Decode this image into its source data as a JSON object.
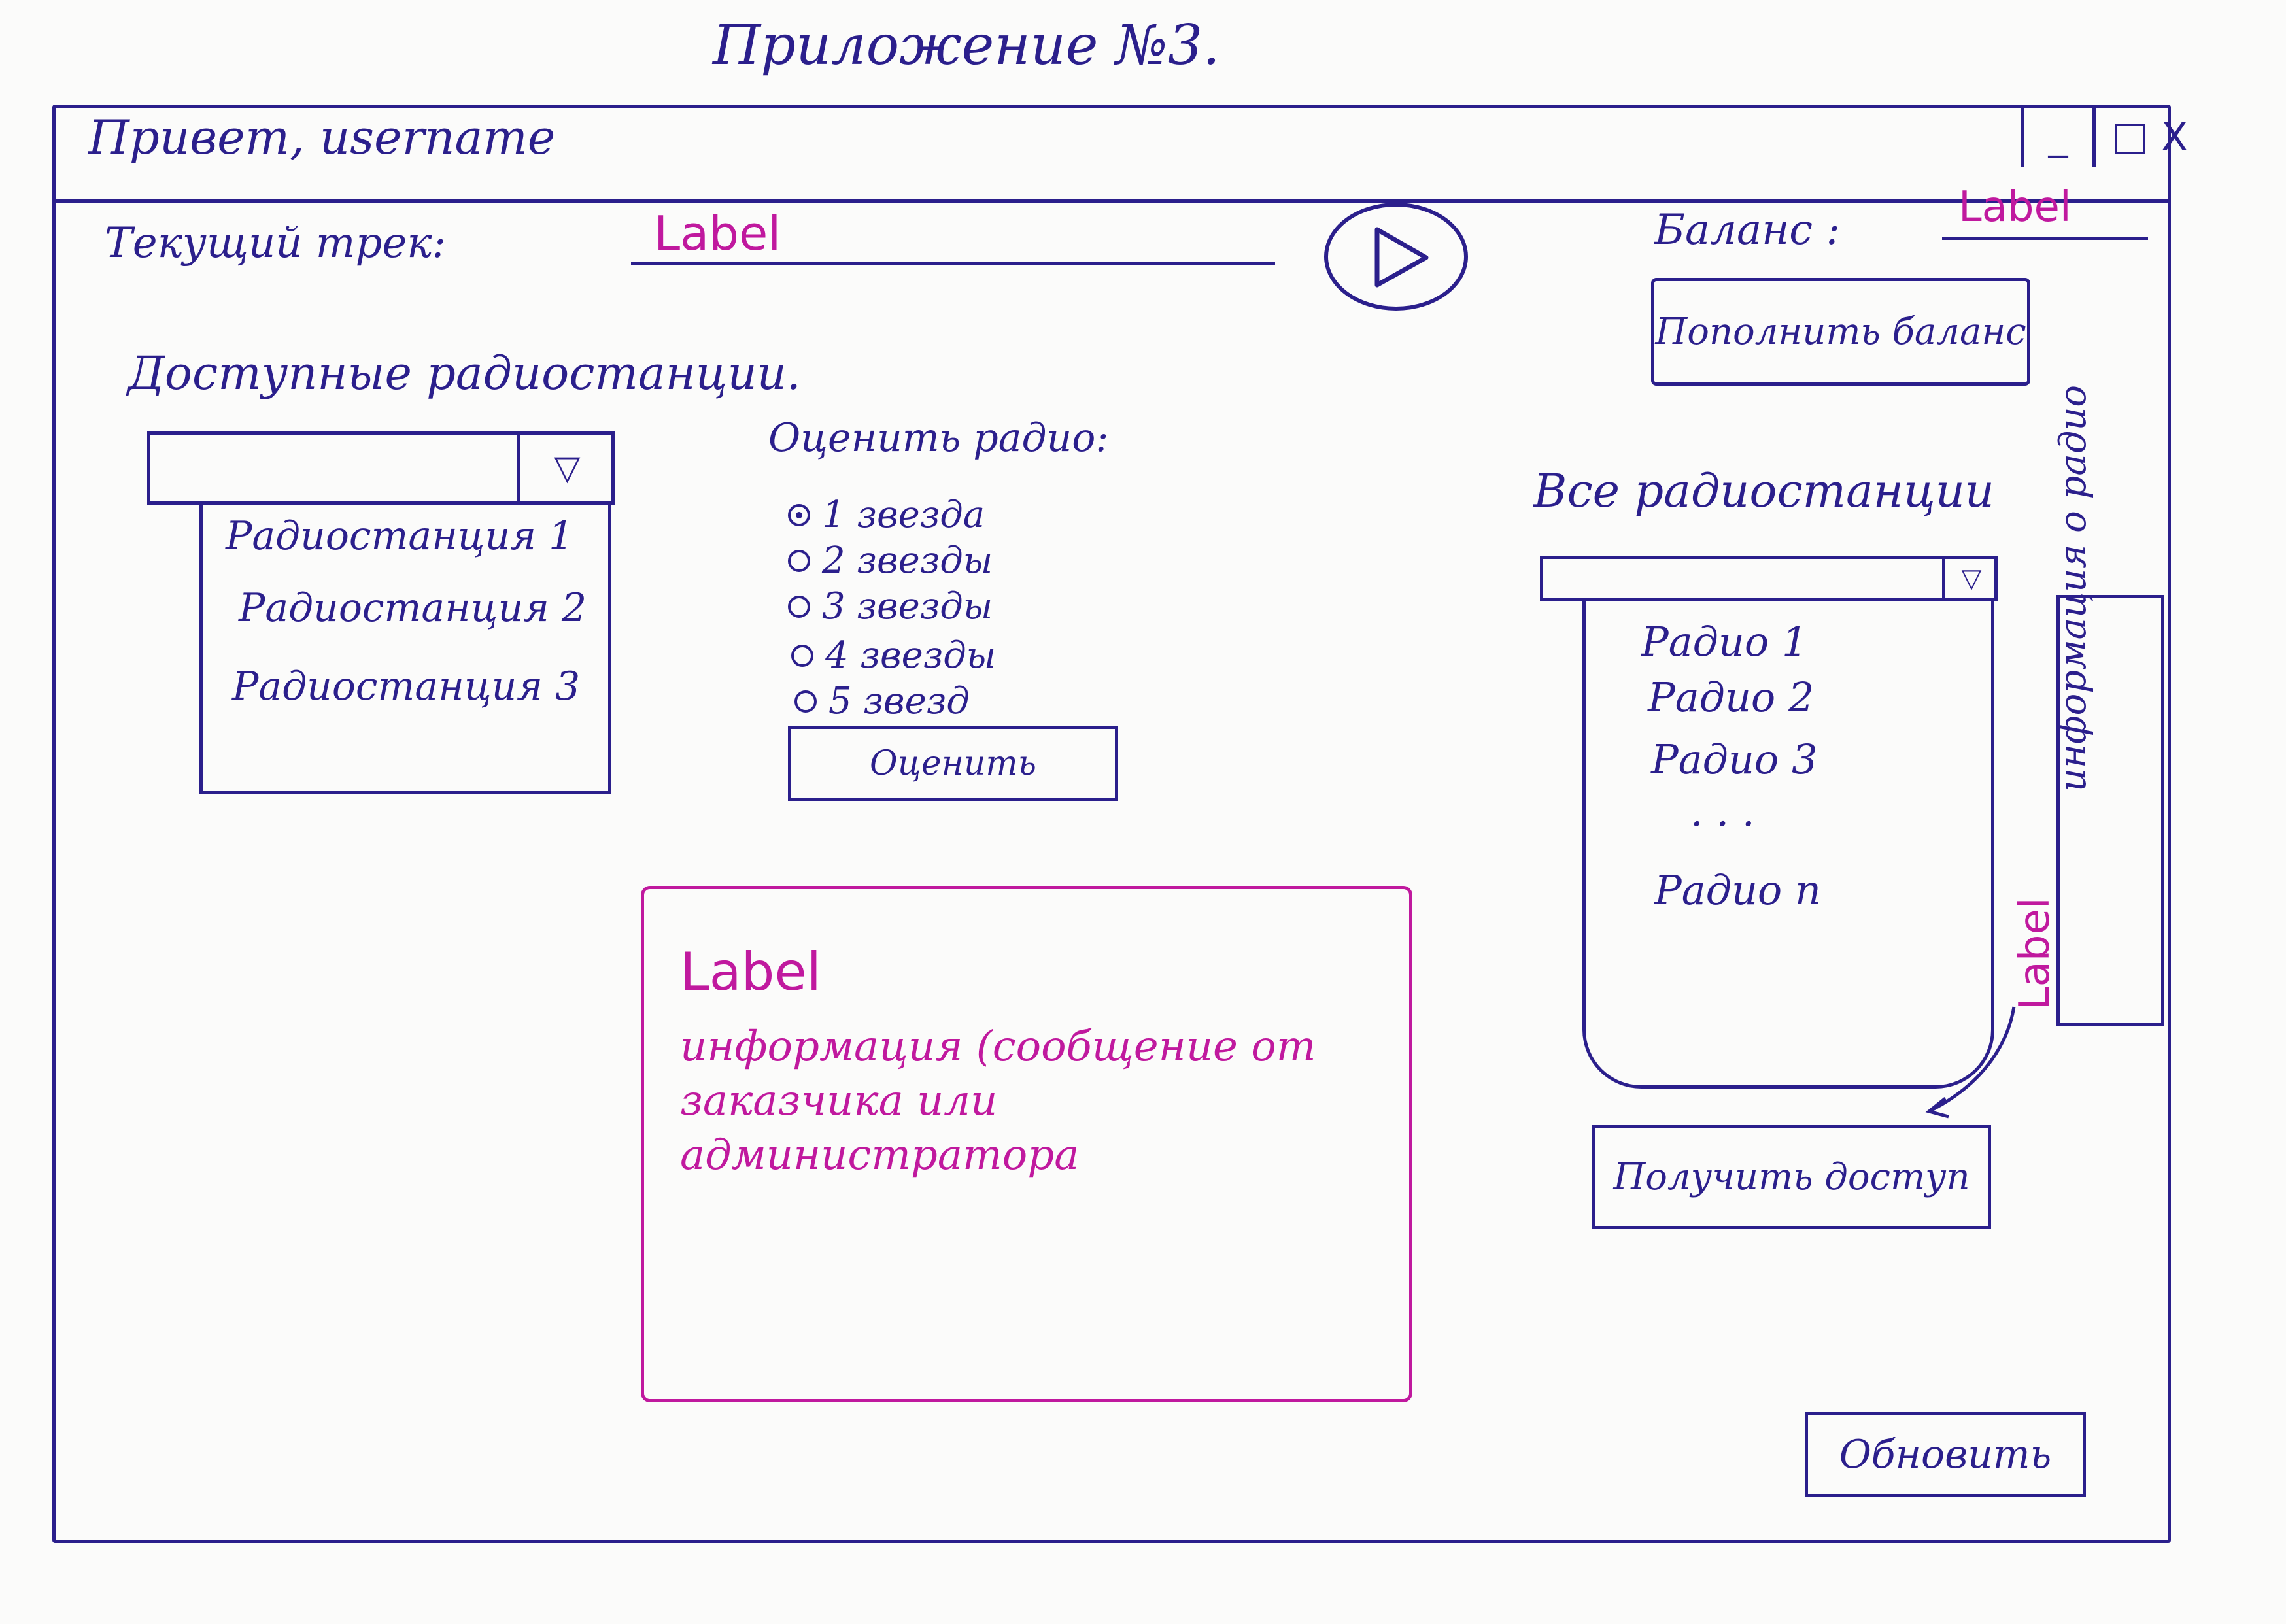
{
  "appendix": "Приложение №3.",
  "window": {
    "title": "Привет, username",
    "buttons": [
      "_",
      "□",
      "X"
    ]
  },
  "track": {
    "label": "Текущий трек:",
    "value": "Label"
  },
  "balance": {
    "label": "Баланс :",
    "value": "Label",
    "topup_label": "Пополнить баланс"
  },
  "available": {
    "title": "Доступные радиостанции.",
    "items": [
      "Радиостанция 1",
      "Радиостанция 2",
      "Радиостанция 3"
    ]
  },
  "rating": {
    "title": "Оценить радио:",
    "options": [
      "1 звезда",
      "2 звезды",
      "3 звезды",
      "4 звезды",
      "5 звезд"
    ],
    "selected_index": 0,
    "button_label": "Оценить"
  },
  "message": {
    "label": "Label",
    "text": "информация (сообщение от заказчика или администратора"
  },
  "all": {
    "title": "Все радиостанции",
    "items": [
      "Радио 1",
      "Радио 2",
      "Радио 3",
      ". . .",
      "Радио n"
    ],
    "info_button": "информация о радио",
    "info_label": "Label",
    "access_button": "Получить доступ"
  },
  "refresh_button": "Обновить"
}
